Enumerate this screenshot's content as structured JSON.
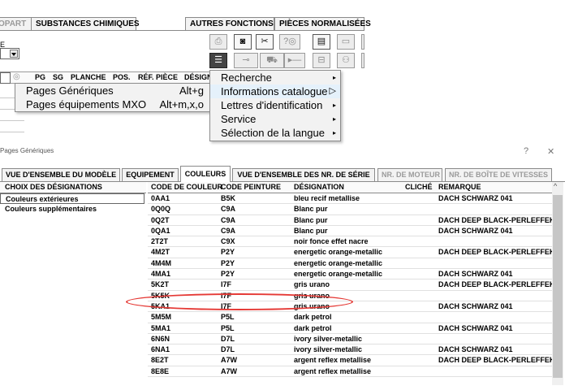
{
  "top_tabs": [
    {
      "label": "OPART"
    },
    {
      "label": "SUBSTANCES CHIMIQUES"
    },
    {
      "label": "AUTRES FONCTIONS ▸"
    },
    {
      "label": "PIÈCES NORMALISÉES"
    }
  ],
  "field_letter": "E",
  "toolbar": {
    "row1": [
      {
        "icon": "printer-icon",
        "glyph": "⎙"
      },
      {
        "icon": "dealer-icon",
        "glyph": "◙"
      },
      {
        "icon": "tools-icon",
        "glyph": "✂"
      },
      {
        "icon": "help-icon",
        "glyph": "?◎"
      },
      {
        "icon": "elsa-icon",
        "glyph": "▤"
      },
      {
        "icon": "computer-icon",
        "glyph": "▭"
      }
    ],
    "row2": [
      {
        "icon": "menu-list-icon",
        "glyph": "☰"
      },
      {
        "icon": "key-icon",
        "glyph": "⊸"
      },
      {
        "icon": "car-icon",
        "glyph": "⛟"
      },
      {
        "icon": "play-icon",
        "glyph": "▸—"
      },
      {
        "icon": "parts-icon",
        "glyph": "⊟"
      },
      {
        "icon": "people-icon",
        "glyph": "⚇"
      }
    ]
  },
  "parts_header": {
    "columns": [
      "PG",
      "SG",
      "PLANCHE",
      "POS.",
      "RÉF. PIÈCE",
      "DÉSIGN"
    ]
  },
  "context_menu_left": {
    "items": [
      {
        "label": "Pages Génériques",
        "accel": "Alt+g"
      },
      {
        "label": "Pages équipements MXO",
        "accel": "Alt+m,x,o"
      }
    ]
  },
  "context_menu_right": {
    "items": [
      {
        "label": "Recherche"
      },
      {
        "label": "Informations catalogue"
      },
      {
        "label": "Lettres d'identification"
      },
      {
        "label": "Service"
      },
      {
        "label": "Sélection de la langue"
      }
    ]
  },
  "window": {
    "title": "Pages Génériques",
    "help": "?",
    "close": "✕"
  },
  "tabs": [
    {
      "label": "VUE D'ENSEMBLE DU MODÈLE"
    },
    {
      "label": "EQUIPEMENT"
    },
    {
      "label": "COULEURS"
    },
    {
      "label": "VUE D'ENSEMBLE DES NR. DE SÉRIE"
    },
    {
      "label": "NR. DE MOTEUR"
    },
    {
      "label": "NR. DE BOÎTE DE VITESSES"
    }
  ],
  "choices": {
    "header": "CHOIX DES DÉSIGNATIONS",
    "items": [
      "Couleurs extérieures",
      "Couleurs supplémentaires"
    ]
  },
  "grid": {
    "columns": [
      "CODE DE COULEUR",
      "CODE PEINTURE",
      "DÉSIGNATION",
      "CLICHÉ",
      "REMARQUE"
    ],
    "rows": [
      [
        "0AA1",
        "B5K",
        "bleu recif metallise",
        "DACH SCHWARZ 041"
      ],
      [
        "0Q0Q",
        "C9A",
        "Blanc pur",
        ""
      ],
      [
        "0Q2T",
        "C9A",
        "Blanc pur",
        "DACH DEEP BLACK-PERLEFFEK"
      ],
      [
        "0QA1",
        "C9A",
        "Blanc pur",
        "DACH SCHWARZ 041"
      ],
      [
        "2T2T",
        "C9X",
        "noir fonce effet nacre",
        ""
      ],
      [
        "4M2T",
        "P2Y",
        "energetic orange-metallic",
        "DACH DEEP BLACK-PERLEFFEK"
      ],
      [
        "4M4M",
        "P2Y",
        "energetic orange-metallic",
        ""
      ],
      [
        "4MA1",
        "P2Y",
        "energetic orange-metallic",
        "DACH SCHWARZ 041"
      ],
      [
        "5K2T",
        "I7F",
        "gris urano",
        "DACH DEEP BLACK-PERLEFFEK"
      ],
      [
        "5K5K",
        "I7F",
        "gris urano",
        ""
      ],
      [
        "5KA1",
        "I7F",
        "gris urano",
        "DACH SCHWARZ 041"
      ],
      [
        "5M5M",
        "P5L",
        "dark petrol",
        ""
      ],
      [
        "5MA1",
        "P5L",
        "dark petrol",
        "DACH SCHWARZ 041"
      ],
      [
        "6N6N",
        "D7L",
        "ivory silver-metallic",
        ""
      ],
      [
        "6NA1",
        "D7L",
        "ivory silver-metallic",
        "DACH SCHWARZ 041"
      ],
      [
        "8E2T",
        "A7W",
        "argent reflex metallise",
        "DACH DEEP BLACK-PERLEFFEK"
      ],
      [
        "8E8E",
        "A7W",
        "argent reflex metallise",
        ""
      ]
    ]
  },
  "scroll_up_glyph": "^",
  "colors": {
    "annotation": "#e53935",
    "highlight": "#e5f1fb"
  }
}
